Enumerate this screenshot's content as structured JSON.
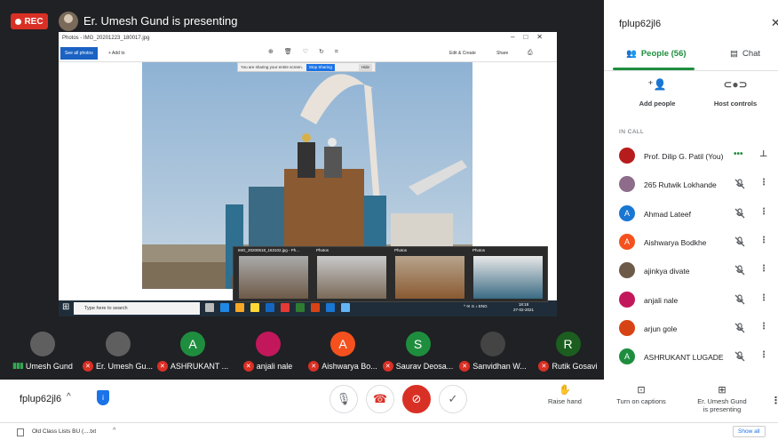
{
  "stage": {
    "rec_label": "REC",
    "presenter_banner": "Er. Umesh Gund is presenting"
  },
  "photos_app": {
    "window_title": "Photos - IMG_20201223_180017.jpg",
    "see_all": "See all photos",
    "add_to": "+ Add to",
    "edit_create": "Edit & Create",
    "share": "Share",
    "sharing_notice": "You are sharing your entire screen.",
    "stop_sharing": "Stop Sharing",
    "hide": "Hide",
    "search_placeholder": "Type here to search",
    "clock_time": "18:18",
    "clock_date": "27-02-2021",
    "tray_lang": "ENG",
    "thumbnails": [
      {
        "title": "IMG_20200518_163102.jpg - Ph..."
      },
      {
        "title": "Photos"
      },
      {
        "title": "Photos"
      },
      {
        "title": "Photos"
      }
    ]
  },
  "tiles": [
    {
      "name": "Umesh Gund",
      "initial": "",
      "color": "#5f5f5f",
      "muted": false
    },
    {
      "name": "Er. Umesh Gu...",
      "initial": "",
      "color": "#5f5f5f",
      "muted": true
    },
    {
      "name": "ASHRUKANT ...",
      "initial": "A",
      "color": "#1e8e3e",
      "muted": true
    },
    {
      "name": "anjali nale",
      "initial": "",
      "color": "#c2185b",
      "muted": true
    },
    {
      "name": "Aishwarya Bo...",
      "initial": "A",
      "color": "#f4511e",
      "muted": true
    },
    {
      "name": "Saurav Deosa...",
      "initial": "S",
      "color": "#1e8e3e",
      "muted": true
    },
    {
      "name": "Sanvidhan W...",
      "initial": "",
      "color": "#444",
      "muted": true
    },
    {
      "name": "Rutik Gosavi",
      "initial": "R",
      "color": "#1b5e20",
      "muted": true
    }
  ],
  "panel": {
    "meeting_code": "fplup62jl6",
    "people_tab": "People (56)",
    "chat_tab": "Chat",
    "add_people": "Add people",
    "host_controls": "Host controls",
    "in_call": "IN CALL",
    "participants": [
      {
        "name": "Prof. Dilip G. Patil (You)",
        "initial": "",
        "color": "#b71c1c",
        "speaking": true
      },
      {
        "name": "265 Rutwik Lokhande",
        "initial": "",
        "color": "#8e6c8a",
        "speaking": false
      },
      {
        "name": "Ahmad Lateef",
        "initial": "A",
        "color": "#1976d2",
        "speaking": false
      },
      {
        "name": "Aishwarya Bodkhe",
        "initial": "A",
        "color": "#f4511e",
        "speaking": false
      },
      {
        "name": "ajinkya divate",
        "initial": "",
        "color": "#6d5a48",
        "speaking": false
      },
      {
        "name": "anjali nale",
        "initial": "",
        "color": "#c2185b",
        "speaking": false
      },
      {
        "name": "arjun gole",
        "initial": "",
        "color": "#d84315",
        "speaking": false
      },
      {
        "name": "ASHRUKANT LUGADE",
        "initial": "A",
        "color": "#1e8e3e",
        "speaking": false
      }
    ]
  },
  "bottom": {
    "meeting_code": "fplup62jl6",
    "raise_hand": "Raise hand",
    "captions": "Turn on captions",
    "presenting_line1": "Er. Umesh Gund",
    "presenting_line2": "is presenting"
  },
  "downloads": {
    "file": "Old Class Lists BU (....txt",
    "show_all": "Show all"
  }
}
